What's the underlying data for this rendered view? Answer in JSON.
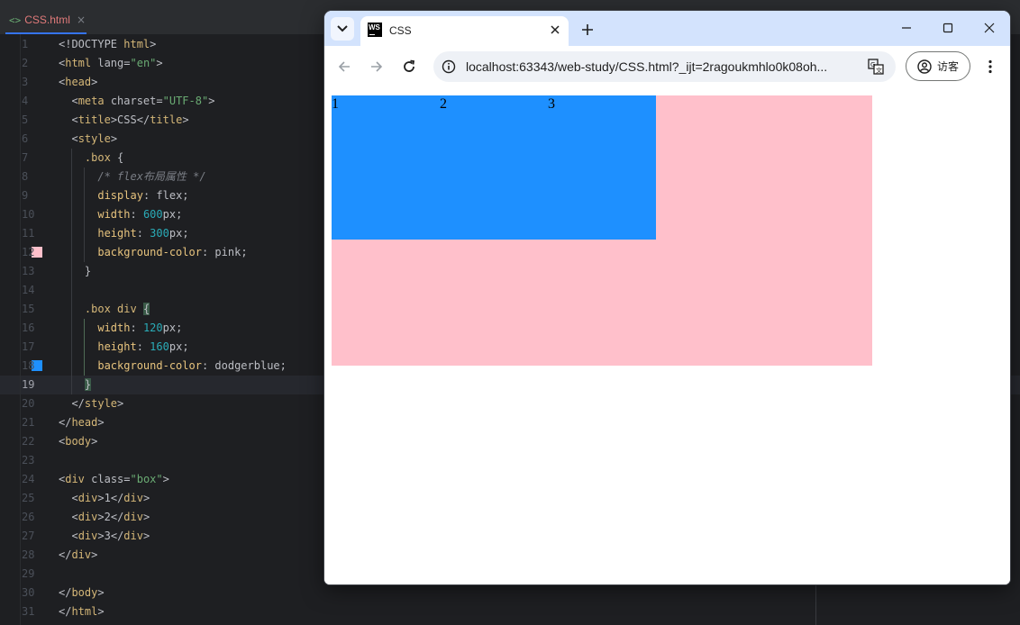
{
  "ide": {
    "tab": {
      "icon": "html-file-icon",
      "glyph": "<>",
      "name": "CSS.html",
      "close": "×"
    },
    "lines": [
      {
        "n": "1"
      },
      {
        "n": "2"
      },
      {
        "n": "3"
      },
      {
        "n": "4"
      },
      {
        "n": "5"
      },
      {
        "n": "6"
      },
      {
        "n": "7"
      },
      {
        "n": "8"
      },
      {
        "n": "9"
      },
      {
        "n": "10"
      },
      {
        "n": "11"
      },
      {
        "n": "12"
      },
      {
        "n": "13"
      },
      {
        "n": "14"
      },
      {
        "n": "15"
      },
      {
        "n": "16"
      },
      {
        "n": "17"
      },
      {
        "n": "18"
      },
      {
        "n": "19"
      },
      {
        "n": "20"
      },
      {
        "n": "21"
      },
      {
        "n": "22"
      },
      {
        "n": "23"
      },
      {
        "n": "24"
      },
      {
        "n": "25"
      },
      {
        "n": "26"
      },
      {
        "n": "27"
      },
      {
        "n": "28"
      },
      {
        "n": "29"
      },
      {
        "n": "30"
      },
      {
        "n": "31"
      }
    ],
    "current_line": "19",
    "swatches": {
      "pink": "#ffc0cb",
      "dodgerblue": "#1e90ff"
    }
  },
  "browser": {
    "tab_title": "CSS",
    "tab_favicon": "webstorm-icon",
    "url": "localhost:63343/web-study/CSS.html?_ijt=2ragoukmhlo0k08oh...",
    "profile_label": "访客",
    "page": {
      "items": [
        "1",
        "2",
        "3"
      ],
      "box_color": "#ffc0cb",
      "item_color": "#1e90ff"
    }
  }
}
